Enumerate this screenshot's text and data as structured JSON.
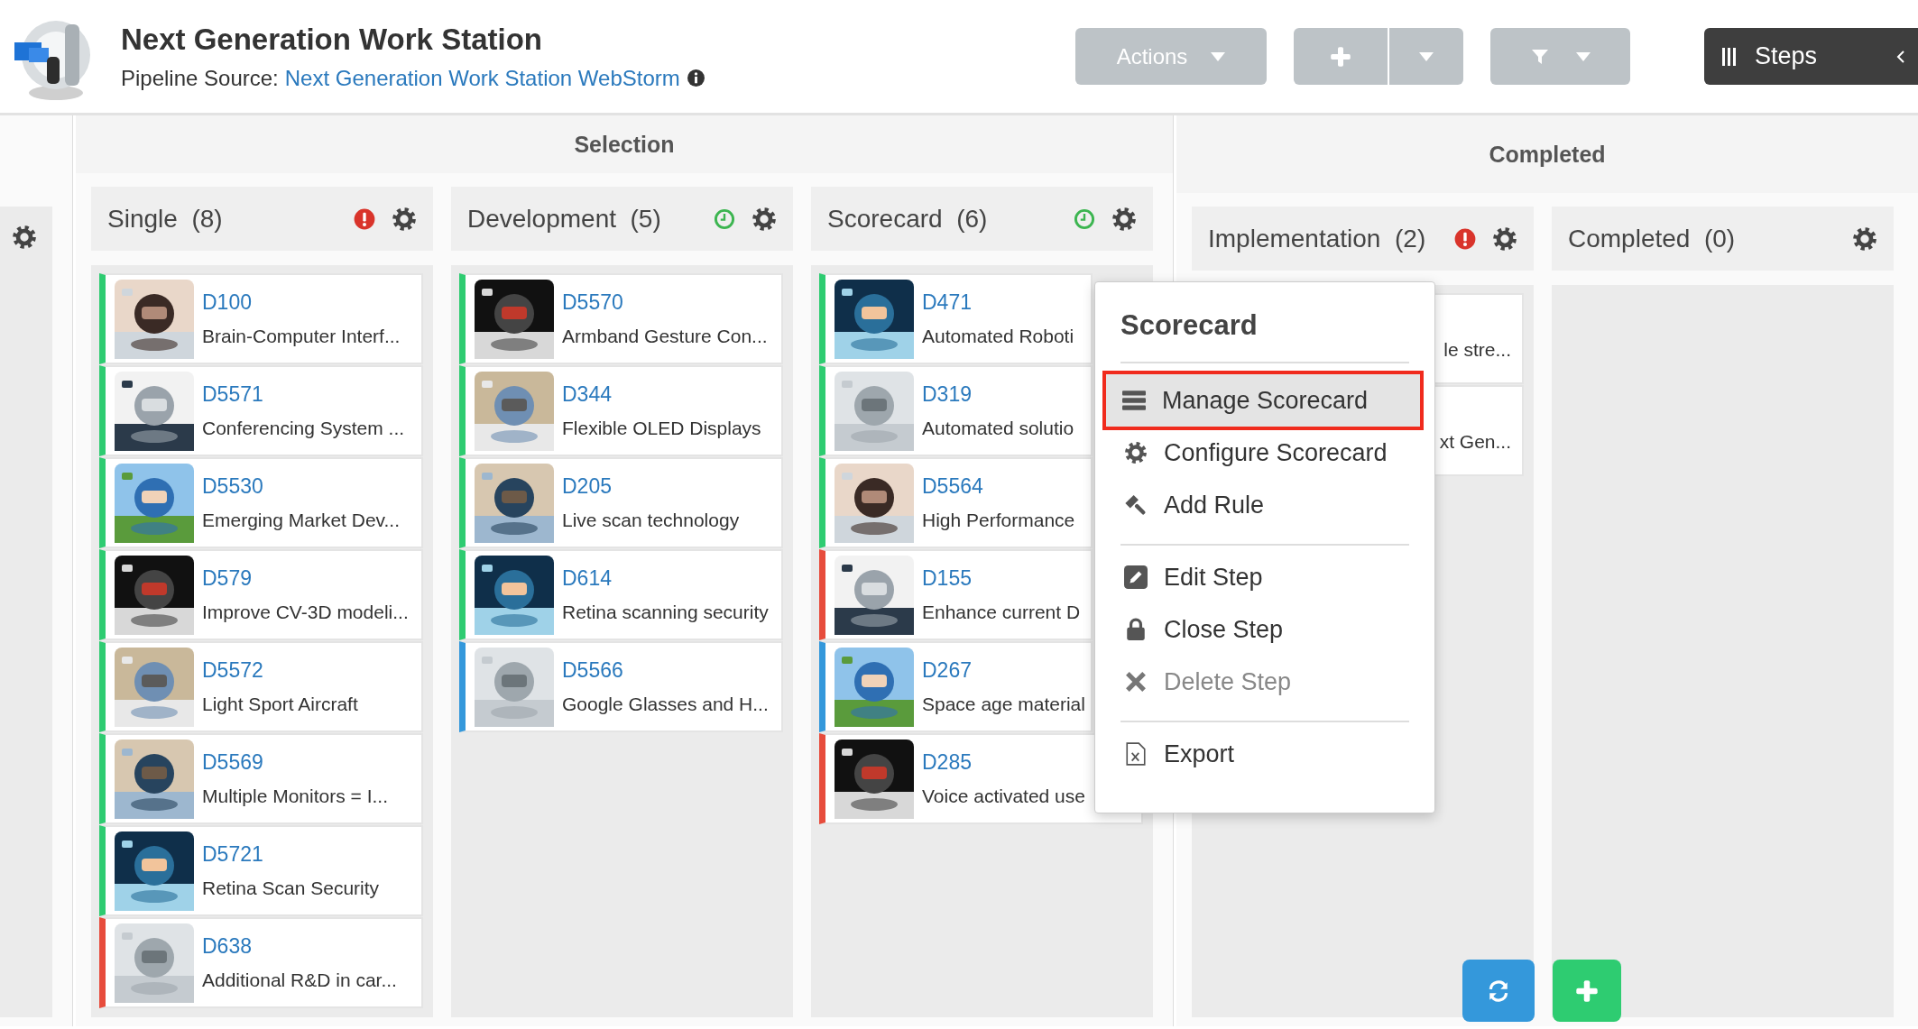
{
  "header": {
    "title": "Next Generation Work Station",
    "source_label": "Pipeline Source:",
    "source_link": "Next Generation Work Station WebStorm"
  },
  "toolbar": {
    "actions": "Actions",
    "steps": "Steps"
  },
  "groups": [
    {
      "title": "Selection",
      "columns": [
        {
          "title": "Single",
          "count": "(8)",
          "kind": "alert",
          "cards": [
            {
              "code": "D100",
              "title": "Brain-Computer Interf...",
              "color": "#2ecc71"
            },
            {
              "code": "D5571",
              "title": "Conferencing System ...",
              "color": "#2ecc71"
            },
            {
              "code": "D5530",
              "title": "Emerging Market Dev...",
              "color": "#2ecc71"
            },
            {
              "code": "D579",
              "title": "Improve CV-3D modeli...",
              "color": "#2ecc71"
            },
            {
              "code": "D5572",
              "title": "Light Sport Aircraft",
              "color": "#2ecc71"
            },
            {
              "code": "D5569",
              "title": "Multiple Monitors = I...",
              "color": "#2ecc71"
            },
            {
              "code": "D5721",
              "title": "Retina Scan Security",
              "color": "#2ecc71"
            },
            {
              "code": "D638",
              "title": "Additional R&D in car...",
              "color": "#e74c3c"
            }
          ]
        },
        {
          "title": "Development",
          "count": "(5)",
          "kind": "clock",
          "cards": [
            {
              "code": "D5570",
              "title": "Armband Gesture Con...",
              "color": "#2ecc71"
            },
            {
              "code": "D344",
              "title": "Flexible OLED Displays",
              "color": "#2ecc71"
            },
            {
              "code": "D205",
              "title": "Live scan technology",
              "color": "#2ecc71"
            },
            {
              "code": "D614",
              "title": "Retina scanning security",
              "color": "#2ecc71"
            },
            {
              "code": "D5566",
              "title": "Google Glasses and H...",
              "color": "#3498db"
            }
          ]
        },
        {
          "title": "Scorecard",
          "count": "(6)",
          "kind": "clock",
          "cards": [
            {
              "code": "D471",
              "title": "Automated Roboti",
              "color": "#2ecc71"
            },
            {
              "code": "D319",
              "title": "Automated solutio",
              "color": "#2ecc71"
            },
            {
              "code": "D5564",
              "title": "High Performance",
              "color": "#2ecc71"
            },
            {
              "code": "D155",
              "title": "Enhance current D",
              "color": "#e74c3c"
            },
            {
              "code": "D267",
              "title": "Space age material",
              "color": "#3498db"
            },
            {
              "code": "D285",
              "title": "Voice activated use",
              "color": "#e74c3c"
            }
          ]
        }
      ]
    },
    {
      "title": "Completed",
      "columns": [
        {
          "title": "Implementation",
          "count": "(2)",
          "kind": "alert",
          "cards": [
            {
              "kind": "partial",
              "title": "le stre..."
            },
            {
              "kind": "partial",
              "title": "xt Gen..."
            }
          ]
        },
        {
          "title": "Completed",
          "count": "(0)"
        }
      ]
    }
  ],
  "menu": {
    "title": "Scorecard",
    "sections": [
      [
        {
          "label": "Manage Scorecard",
          "selected": true,
          "disabled": false
        },
        {
          "label": "Configure Scorecard",
          "selected": false,
          "disabled": false
        },
        {
          "label": "Add Rule",
          "selected": false,
          "disabled": false
        }
      ],
      [
        {
          "label": "Edit Step",
          "selected": false,
          "disabled": false
        },
        {
          "label": "Close Step",
          "selected": false,
          "disabled": false
        },
        {
          "label": "Delete Step",
          "selected": false,
          "disabled": true
        }
      ],
      [
        {
          "label": "Export",
          "selected": false,
          "disabled": false
        }
      ]
    ]
  }
}
